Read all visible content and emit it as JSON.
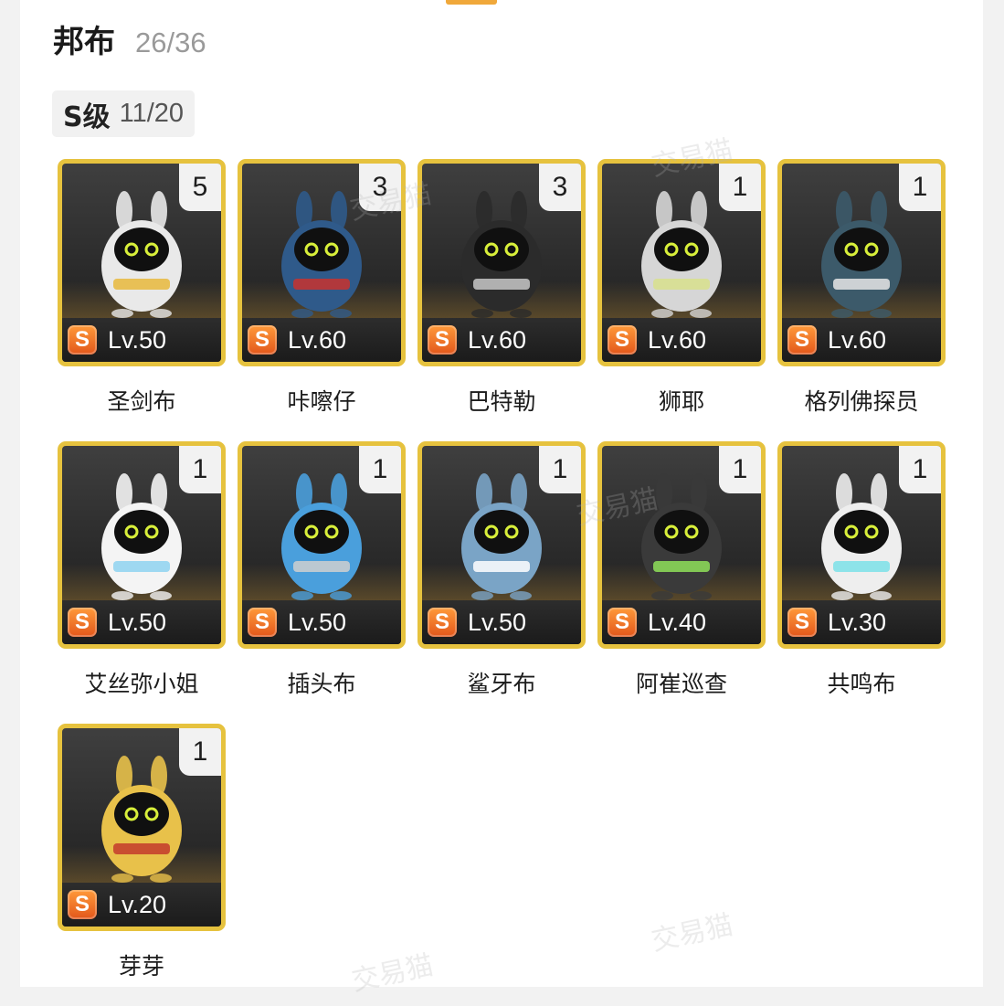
{
  "header": {
    "title": "邦布",
    "count": "26/36"
  },
  "tier": {
    "name": "S级",
    "count": "11/20"
  },
  "accent_color": "#e6c23e",
  "rank_icon_color": "#e2571b",
  "items": [
    {
      "name": "圣剑布",
      "count": "5",
      "rank": "S",
      "level": "Lv.50",
      "icon": "crowned-rabbit-figure-icon",
      "color": "#e9e9e9",
      "accent": "#e7b93c"
    },
    {
      "name": "咔嚓仔",
      "count": "3",
      "rank": "S",
      "level": "Lv.60",
      "icon": "red-cap-figure-icon",
      "color": "#2f5a8a",
      "accent": "#c8322e"
    },
    {
      "name": "巴特勒",
      "count": "3",
      "rank": "S",
      "level": "Lv.60",
      "icon": "butler-figure-icon",
      "color": "#2b2b2b",
      "accent": "#c8c8c8"
    },
    {
      "name": "狮耶",
      "count": "1",
      "rank": "S",
      "level": "Lv.60",
      "icon": "lion-figure-icon",
      "color": "#d6d6d6",
      "accent": "#d8e08c"
    },
    {
      "name": "格列佛探员",
      "count": "1",
      "rank": "S",
      "level": "Lv.60",
      "icon": "agent-figure-icon",
      "color": "#3c5a6a",
      "accent": "#e6e6e6"
    },
    {
      "name": "艾丝弥小姐",
      "count": "1",
      "rank": "S",
      "level": "Lv.50",
      "icon": "ghost-dress-figure-icon",
      "color": "#f4f4f4",
      "accent": "#8ed2f0"
    },
    {
      "name": "插头布",
      "count": "1",
      "rank": "S",
      "level": "Lv.50",
      "icon": "plug-figure-icon",
      "color": "#4a9fdc",
      "accent": "#cfcfcf"
    },
    {
      "name": "鲨牙布",
      "count": "1",
      "rank": "S",
      "level": "Lv.50",
      "icon": "shark-figure-icon",
      "color": "#7aa4c6",
      "accent": "#ffffff"
    },
    {
      "name": "阿崔巡查",
      "count": "1",
      "rank": "S",
      "level": "Lv.40",
      "icon": "patrol-figure-icon",
      "color": "#3a3a3a",
      "accent": "#8fe05a"
    },
    {
      "name": "共鸣布",
      "count": "1",
      "rank": "S",
      "level": "Lv.30",
      "icon": "speaker-figure-icon",
      "color": "#eeeeee",
      "accent": "#7be0e8"
    },
    {
      "name": "芽芽",
      "count": "1",
      "rank": "S",
      "level": "Lv.20",
      "icon": "sprout-figure-icon",
      "color": "#e8c14a",
      "accent": "#c33a2c"
    }
  ],
  "watermark": "交易猫"
}
